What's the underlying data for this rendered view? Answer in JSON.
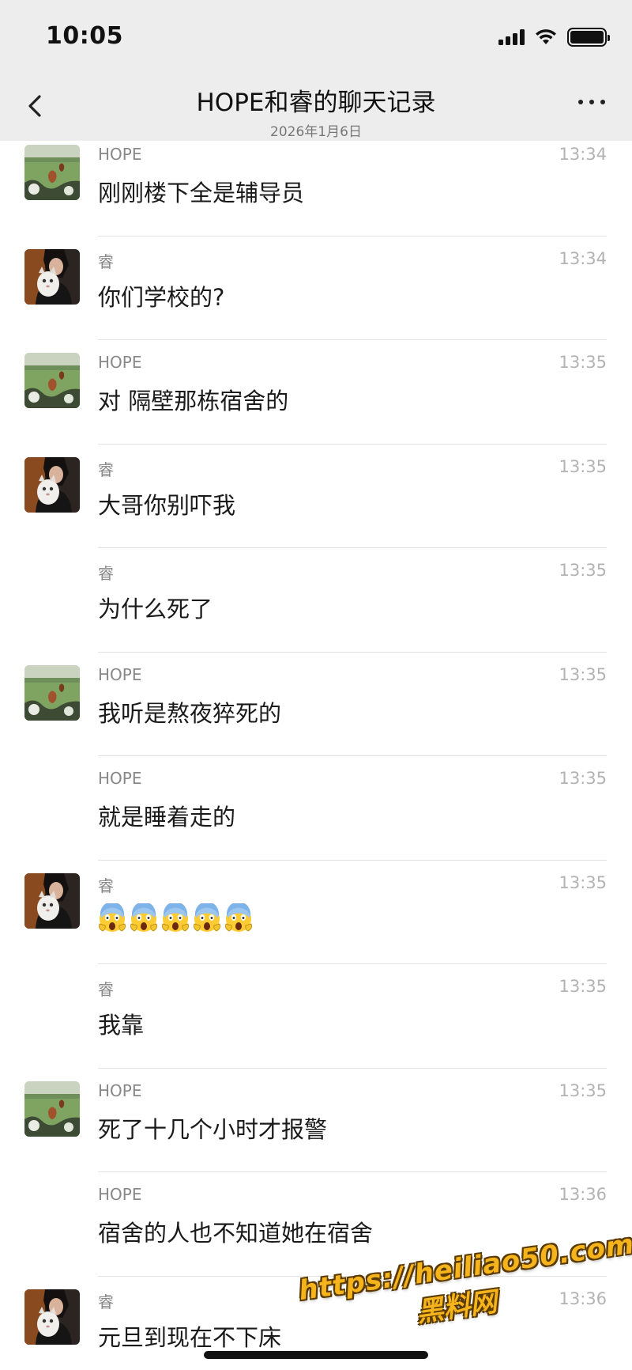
{
  "status_bar": {
    "time": "10:05"
  },
  "header": {
    "title": "HOPE和睿的聊天记录",
    "date": "2026年1月6日"
  },
  "messages": [
    {
      "sender": "HOPE",
      "time": "13:34",
      "text": "刚刚楼下全是辅导员",
      "avatar": "hope"
    },
    {
      "sender": "睿",
      "time": "13:34",
      "text": "你们学校的?",
      "avatar": "rui"
    },
    {
      "sender": "HOPE",
      "time": "13:35",
      "text": "对 隔壁那栋宿舍的",
      "avatar": "hope"
    },
    {
      "sender": "睿",
      "time": "13:35",
      "text": "大哥你别吓我",
      "avatar": "rui"
    },
    {
      "sender": "睿",
      "time": "13:35",
      "text": "为什么死了",
      "avatar": "none"
    },
    {
      "sender": "HOPE",
      "time": "13:35",
      "text": "我听是熬夜猝死的",
      "avatar": "hope"
    },
    {
      "sender": "HOPE",
      "time": "13:35",
      "text": "就是睡着走的",
      "avatar": "none"
    },
    {
      "sender": "睿",
      "time": "13:35",
      "text": "",
      "emoji": [
        "scream-emoji",
        "scream-emoji",
        "scream-emoji",
        "scream-emoji",
        "scream-emoji"
      ],
      "avatar": "rui"
    },
    {
      "sender": "睿",
      "time": "13:35",
      "text": "我靠",
      "avatar": "none"
    },
    {
      "sender": "HOPE",
      "time": "13:35",
      "text": "死了十几个小时才报警",
      "avatar": "hope"
    },
    {
      "sender": "HOPE",
      "time": "13:36",
      "text": "宿舍的人也不知道她在宿舍",
      "avatar": "none"
    },
    {
      "sender": "睿",
      "time": "13:36",
      "text": "元旦到现在不下床",
      "avatar": "rui"
    }
  ],
  "watermark": {
    "url": "https://heiliao50.com",
    "label": "黑料网"
  },
  "icons": {
    "back": "chevron-left-icon",
    "more": "more-dots-icon",
    "signal": "signal-icon",
    "wifi": "wifi-icon",
    "battery": "battery-icon"
  },
  "colors": {
    "header_bg": "#ededed",
    "watermark": "#f6b41c"
  }
}
